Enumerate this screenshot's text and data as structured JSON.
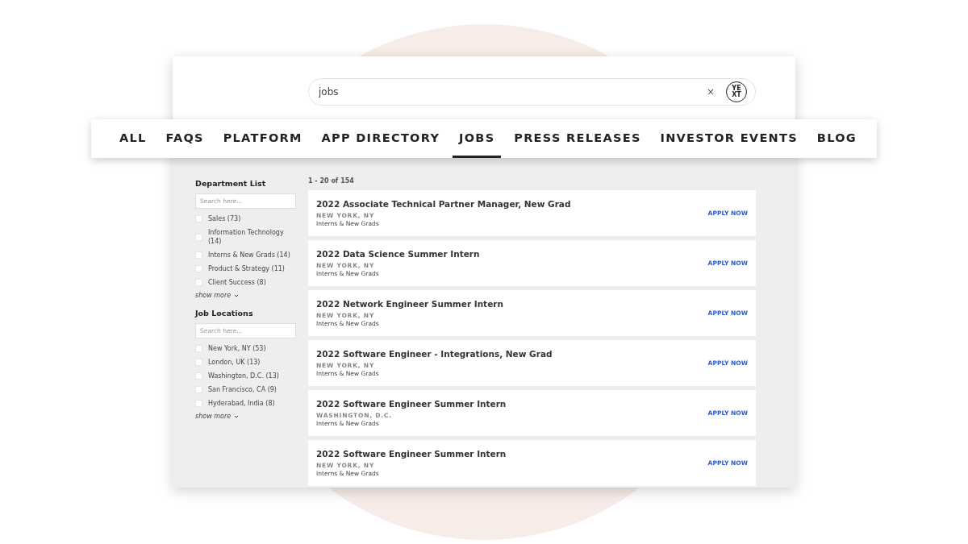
{
  "search": {
    "value": "jobs",
    "clear": "×",
    "logo_lines": [
      "YE",
      "XT"
    ]
  },
  "tabs": [
    {
      "label": "ALL",
      "selected": false
    },
    {
      "label": "FAQS",
      "selected": false
    },
    {
      "label": "PLATFORM",
      "selected": false
    },
    {
      "label": "APP DIRECTORY",
      "selected": false
    },
    {
      "label": "JOBS",
      "selected": true
    },
    {
      "label": "PRESS RELEASES",
      "selected": false
    },
    {
      "label": "INVESTOR EVENTS",
      "selected": false
    },
    {
      "label": "BLOG",
      "selected": false
    }
  ],
  "facets": [
    {
      "title": "Department List",
      "placeholder": "Search here...",
      "show_more": "show more",
      "options": [
        {
          "label": "Sales (73)",
          "checked": false
        },
        {
          "label": "Information Technology (14)",
          "checked": false
        },
        {
          "label": "Interns & New Grads (14)",
          "checked": false
        },
        {
          "label": "Product & Strategy (11)",
          "checked": false
        },
        {
          "label": "Client Success (8)",
          "checked": false
        }
      ]
    },
    {
      "title": "Job Locations",
      "placeholder": "Search here...",
      "show_more": "show more",
      "options": [
        {
          "label": "New York, NY (53)",
          "checked": false
        },
        {
          "label": "London, UK (13)",
          "checked": false
        },
        {
          "label": "Washington, D.C. (13)",
          "checked": false
        },
        {
          "label": "San Francisco, CA (9)",
          "checked": false
        },
        {
          "label": "Hyderabad, India (8)",
          "checked": false
        }
      ]
    }
  ],
  "results_count": "1 - 20 of 154",
  "jobs": [
    {
      "title": "2022 Associate Technical Partner Manager, New Grad",
      "location": "NEW YORK, NY",
      "department": "Interns & New Grads",
      "action": "APPLY NOW"
    },
    {
      "title": "2022 Data Science Summer Intern",
      "location": "NEW YORK, NY",
      "department": "Interns & New Grads",
      "action": "APPLY NOW"
    },
    {
      "title": "2022 Network Engineer Summer Intern",
      "location": "NEW YORK, NY",
      "department": "Interns & New Grads",
      "action": "APPLY NOW"
    },
    {
      "title": "2022 Software Engineer - Integrations, New Grad",
      "location": "NEW YORK, NY",
      "department": "Interns & New Grads",
      "action": "APPLY NOW"
    },
    {
      "title": "2022 Software Engineer Summer Intern",
      "location": "WASHINGTON, D.C.",
      "department": "Interns & New Grads",
      "action": "APPLY NOW"
    },
    {
      "title": "2022 Software Engineer Summer Intern",
      "location": "NEW YORK, NY",
      "department": "Interns & New Grads",
      "action": "APPLY NOW"
    }
  ]
}
